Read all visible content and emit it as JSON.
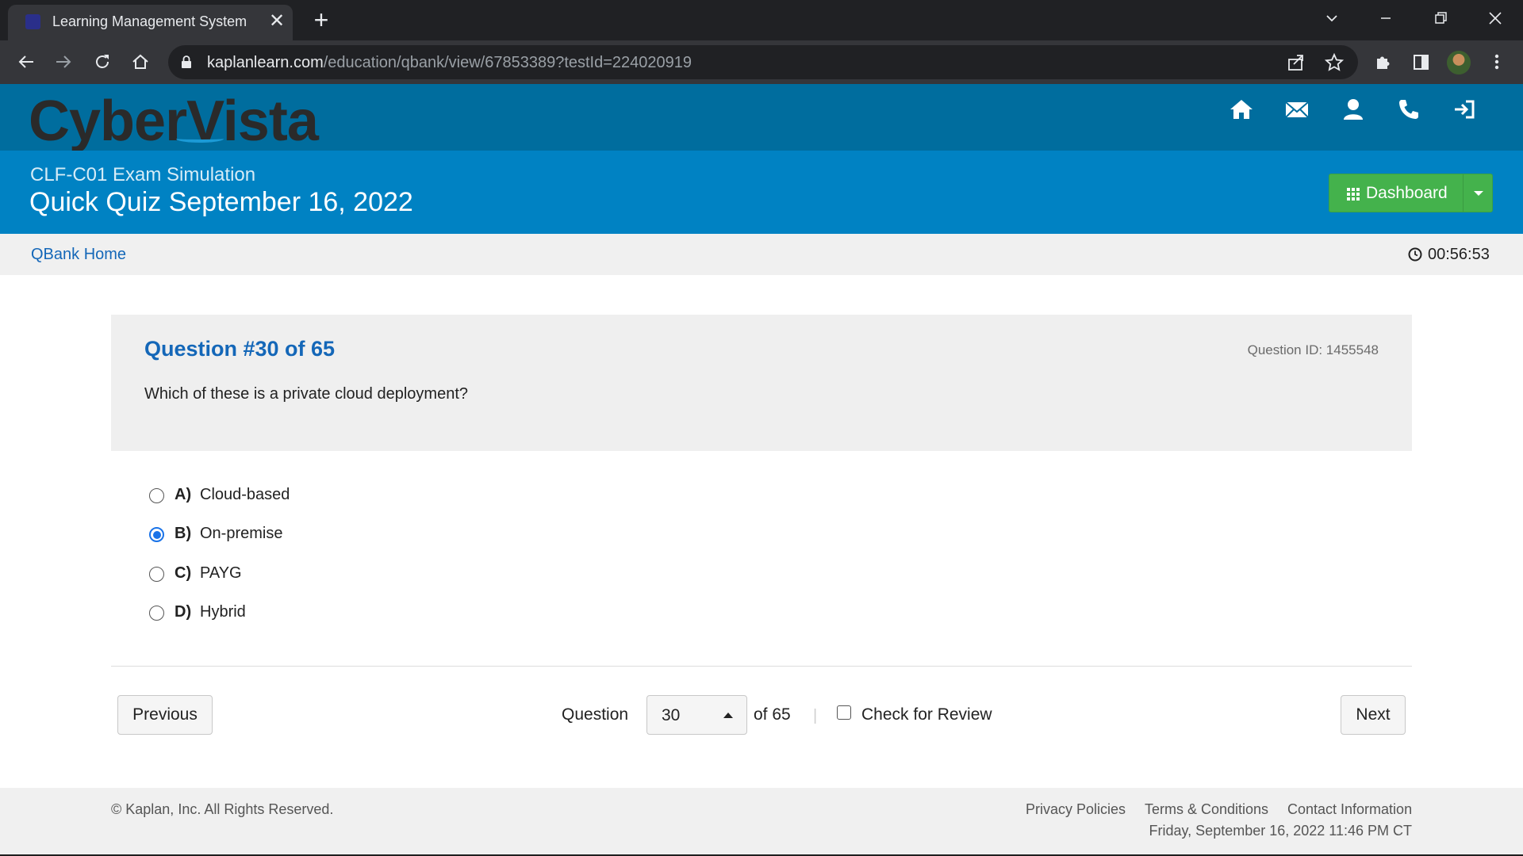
{
  "browser": {
    "tab_title": "Learning Management System",
    "tab_close": "✕",
    "new_tab": "+",
    "url_host": "kaplanlearn.com",
    "url_path": "/education/qbank/view/67853389?testId=224020919",
    "icons": [
      "back-icon",
      "forward-icon",
      "reload-icon",
      "home-icon",
      "lock-icon",
      "share-icon",
      "star-icon",
      "extensions-icon",
      "side-panel-icon",
      "profile-avatar",
      "menu-icon"
    ]
  },
  "header": {
    "logo": "CyberVista",
    "icons": [
      "home-icon",
      "mail-icon",
      "user-icon",
      "phone-icon",
      "logout-icon"
    ]
  },
  "title_band": {
    "course": "CLF-C01 Exam Simulation",
    "quiz_title": "Quick Quiz September 16, 2022",
    "dashboard_label": "Dashboard"
  },
  "subnav": {
    "qbank_home": "QBank Home",
    "timer": "00:56:53"
  },
  "question": {
    "number_label": "Question #30 of 65",
    "id_label": "Question ID: 1455548",
    "text": "Which of these is a private cloud deployment?",
    "choices": [
      {
        "letter": "A)",
        "text": "Cloud-based",
        "selected": false
      },
      {
        "letter": "B)",
        "text": "On-premise",
        "selected": true
      },
      {
        "letter": "C)",
        "text": "PAYG",
        "selected": false
      },
      {
        "letter": "D)",
        "text": "Hybrid",
        "selected": false
      }
    ]
  },
  "navigation": {
    "previous": "Previous",
    "question_label": "Question",
    "current": "30",
    "of_total": "of 65",
    "separator": "|",
    "check_review": "Check for Review",
    "next": "Next"
  },
  "footer": {
    "copyright": "© Kaplan, Inc. All Rights Reserved.",
    "links": [
      "Privacy Policies",
      "Terms & Conditions",
      "Contact Information"
    ],
    "datetime": "Friday, September 16, 2022 11:46 PM CT"
  },
  "colors": {
    "header_blue": "#006d9e",
    "band_blue": "#0082c3",
    "link_blue": "#1467b8",
    "dashboard_green": "#44b24c",
    "radio_selected": "#1a73e8"
  }
}
